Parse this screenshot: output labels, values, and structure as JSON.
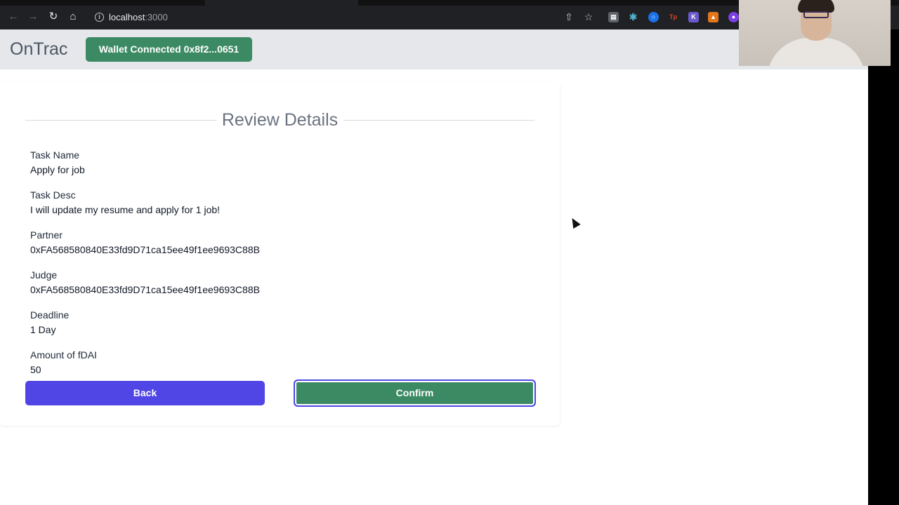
{
  "browser": {
    "url_host": "localhost",
    "url_port": ":3000",
    "back_icon": "arrow-left-icon",
    "forward_icon": "arrow-right-icon",
    "reload_icon": "reload-icon",
    "home_icon": "home-icon",
    "share_icon": "share-icon",
    "bookmark_icon": "star-icon"
  },
  "header": {
    "brand": "OnTrac",
    "wallet_label": "Wallet Connected 0x8f2...0651",
    "wallet_color": "#3c8a64"
  },
  "review": {
    "title": "Review Details",
    "fields": [
      {
        "label": "Task Name",
        "value": "Apply for job"
      },
      {
        "label": "Task Desc",
        "value": "I will update my resume and apply for 1 job!"
      },
      {
        "label": "Partner",
        "value": "0xFA568580840E33fd9D71ca15ee49f1ee9693C88B"
      },
      {
        "label": "Judge",
        "value": "0xFA568580840E33fd9D71ca15ee49f1ee9693C88B"
      },
      {
        "label": "Deadline",
        "value": "1 Day"
      },
      {
        "label": "Amount of fDAI",
        "value": "50"
      }
    ],
    "back_label": "Back",
    "confirm_label": "Confirm",
    "back_color": "#4f46e5",
    "confirm_color": "#3c8a64"
  }
}
